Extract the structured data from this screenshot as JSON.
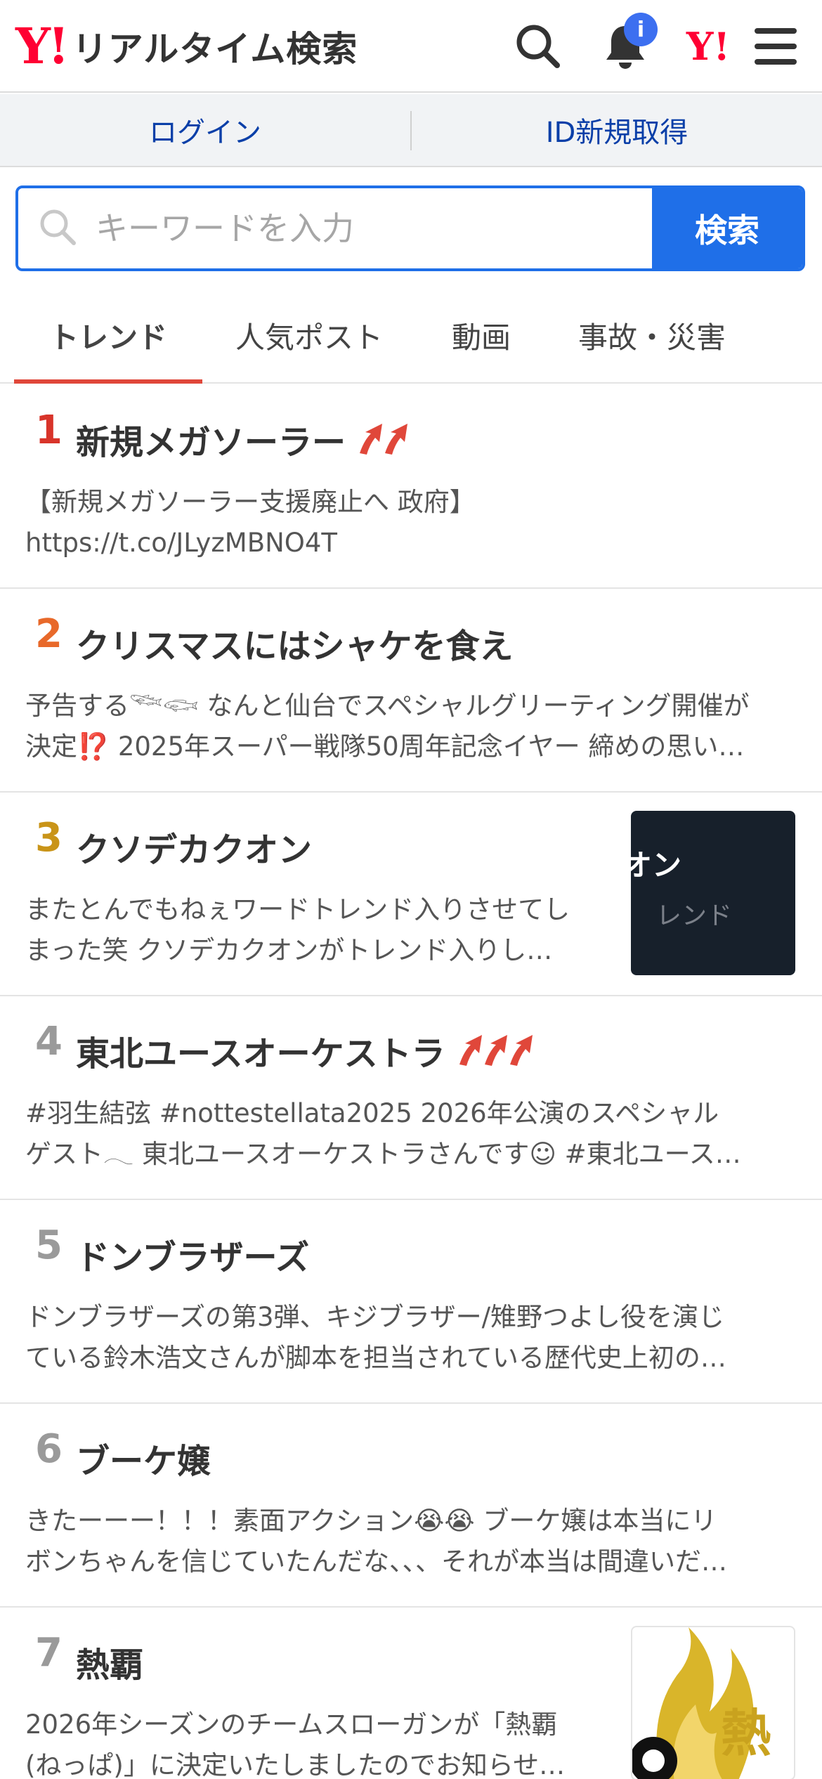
{
  "header": {
    "logo_y": "Y",
    "logo_ex": "!",
    "logo_text": "リアルタイム検索",
    "notification_badge": "i",
    "yahoo_link": "Y!"
  },
  "login_bar": {
    "login": "ログイン",
    "register": "ID新規取得"
  },
  "search": {
    "placeholder": "キーワードを入力",
    "button": "検索"
  },
  "tabs": [
    {
      "label": "トレンド",
      "active": true
    },
    {
      "label": "人気ポスト",
      "active": false
    },
    {
      "label": "動画",
      "active": false
    },
    {
      "label": "事故・災害",
      "active": false
    }
  ],
  "trends": [
    {
      "rank": "1",
      "title": "新規メガソーラー",
      "arrows": 2,
      "snippet_lines": [
        "【新規メガソーラー支援廃止へ 政府】",
        "https://t.co/JLyzMBNO4T"
      ]
    },
    {
      "rank": "2",
      "title": "クリスマスにはシャケを食え",
      "arrows": 0,
      "snippet_lines": [
        "予告する𓆝𓆟 なんと仙台でスペシャルグリーティング開催が",
        "決定⁉️ 2025年スーパー戦隊50周年記念イヤー 締めの思い…"
      ]
    },
    {
      "rank": "3",
      "title": "クソデカクオン",
      "arrows": 0,
      "snippet_lines": [
        "またとんでもねぇワードトレンド入りさせてし",
        "まった笑 クソデカクオンがトレンド入りし…"
      ],
      "thumb_text_1": "オン",
      "thumb_text_2": "レンド"
    },
    {
      "rank": "4",
      "title": "東北ユースオーケストラ",
      "arrows": 3,
      "snippet_lines": [
        "#羽生結弦 #nottestellata2025 2026年公演のスペシャル",
        "ゲスト𓂃 東北ユースオーケストラさんです☺ #東北ユース…"
      ]
    },
    {
      "rank": "5",
      "title": "ドンブラザーズ",
      "arrows": 0,
      "snippet_lines": [
        "ドンブラザーズの第3弾、キジブラザー/雉野つよし役を演じ",
        "ている鈴木浩文さんが脚本を担当されている歴代史上初の…"
      ]
    },
    {
      "rank": "6",
      "title": "ブーケ嬢",
      "arrows": 0,
      "snippet_lines": [
        "きたーーー！！！素面アクション😭😭 ブーケ嬢は本当にリ",
        "ボンちゃんを信じていたんだな、、、それが本当は間違いだ…"
      ]
    },
    {
      "rank": "7",
      "title": "熱覇",
      "arrows": 0,
      "snippet_lines": [
        "2026年シーズンのチームスローガンが「熱覇",
        "(ねっぱ)」に決定いたしましたのでお知らせ…"
      ],
      "thumb_text_1": "熱"
    }
  ],
  "colors": {
    "accent_blue": "#1f6fe8",
    "yahoo_red": "#ff0033",
    "tab_underline": "#e0473a",
    "rank1": "#d8342a",
    "rank2": "#e8692a",
    "rank3": "#c99418",
    "rank_other": "#9a9a9a"
  },
  "icons": [
    "search-icon",
    "bell-icon",
    "menu-icon",
    "magnifier-icon",
    "trend-up-arrow-icon"
  ]
}
